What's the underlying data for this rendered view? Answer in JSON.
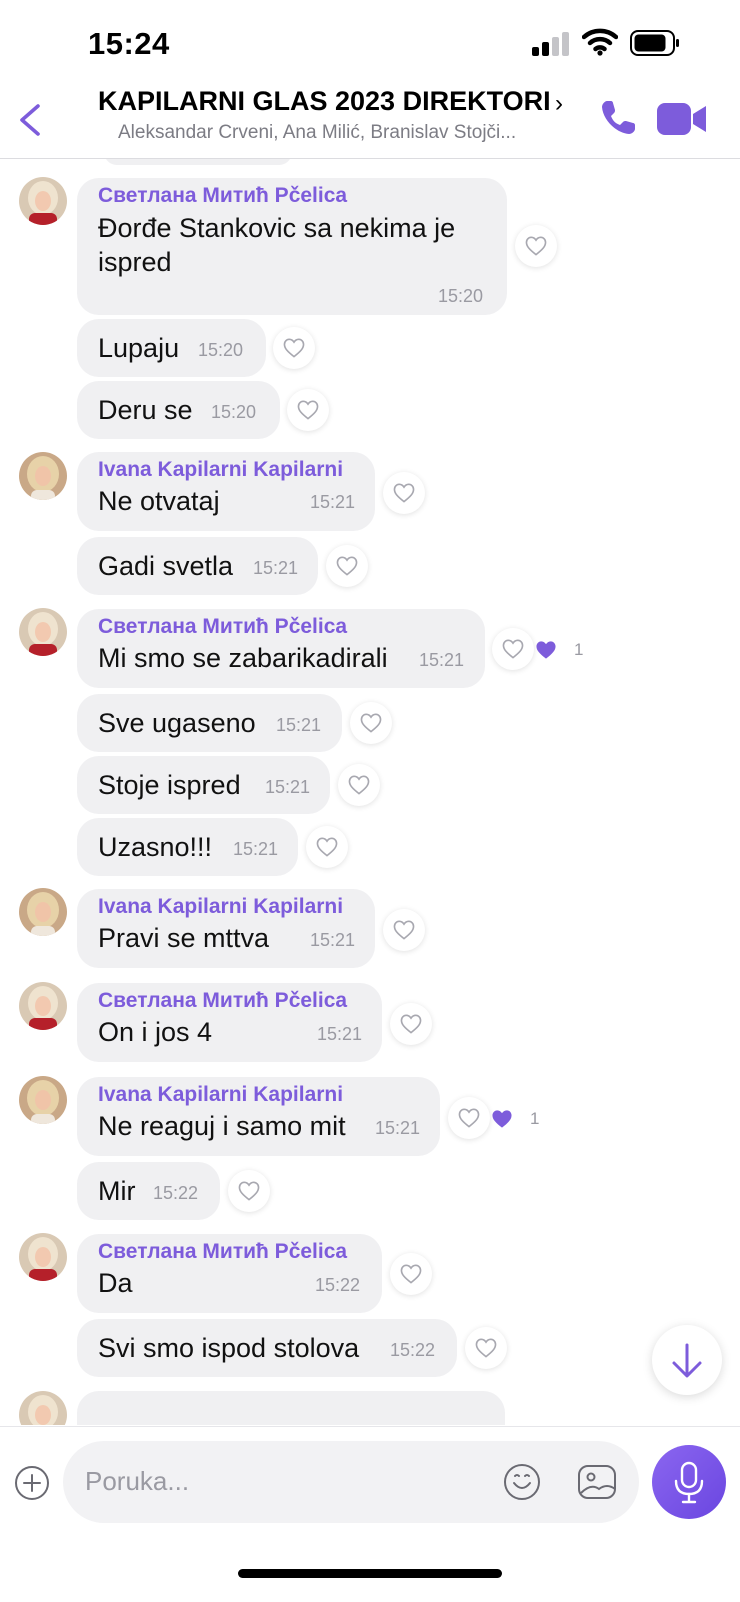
{
  "status_bar": {
    "time": "15:24"
  },
  "header": {
    "title": "KAPILARNI GLAS 2023 DIREKTORI",
    "chevron": "›",
    "members": "Aleksandar Crveni, Ana Milić, Branislav Stojči..."
  },
  "composer": {
    "placeholder": "Poruka..."
  },
  "colors": {
    "accent": "#7d5cdb",
    "bubble": "#f0f0f2",
    "timestamp": "#9a9aa2"
  },
  "icons": [
    "back-icon",
    "phone-icon",
    "video-call-icon",
    "heart-icon",
    "arrow-down-icon",
    "plus-icon",
    "emoji-icon",
    "gallery-icon",
    "microphone-icon"
  ],
  "messages": [
    {
      "sender": "Светлана Митић Pčelica",
      "lines": [
        "Đorđe Stankovic sa nekima je",
        "ispred"
      ],
      "time": "15:20"
    },
    {
      "text": "Lupaju",
      "time": "15:20"
    },
    {
      "text": "Deru se",
      "time": "15:20"
    },
    {
      "sender": "Ivana Kapilarni Kapilarni",
      "text": "Ne otvataj",
      "time": "15:21"
    },
    {
      "text": "Gadi svetla",
      "time": "15:21"
    },
    {
      "sender": "Светлана Митић Pčelica",
      "text": "Mi smo se zabarikadirali",
      "time": "15:21",
      "likes": "1"
    },
    {
      "text": "Sve ugaseno",
      "time": "15:21"
    },
    {
      "text": "Stoje ispred",
      "time": "15:21"
    },
    {
      "text": "Uzasno!!!",
      "time": "15:21"
    },
    {
      "sender": "Ivana Kapilarni Kapilarni",
      "text": "Pravi se mttva",
      "time": "15:21"
    },
    {
      "sender": "Светлана Митић Pčelica",
      "text": "On i jos 4",
      "time": "15:21"
    },
    {
      "sender": "Ivana Kapilarni Kapilarni",
      "text": "Ne reaguj i samo mit",
      "time": "15:21",
      "likes": "1"
    },
    {
      "text": "Mir",
      "time": "15:22"
    },
    {
      "sender": "Светлана Митић Pčelica",
      "text": "Da",
      "time": "15:22"
    },
    {
      "text": "Svi smo ispod stolova",
      "time": "15:22"
    }
  ]
}
